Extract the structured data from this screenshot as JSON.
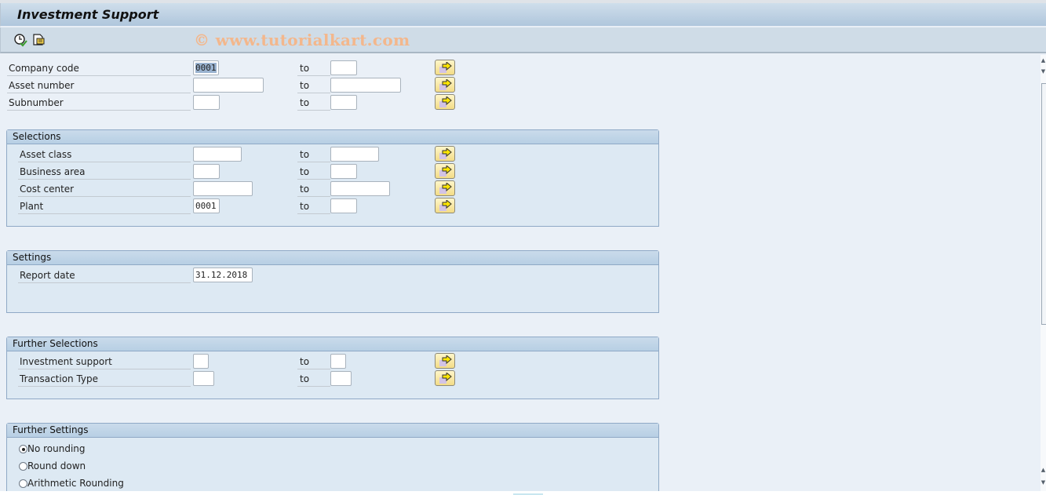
{
  "window": {
    "title": "Investment Support"
  },
  "toolbar": {
    "icons": [
      "execute-icon",
      "get-variant-icon"
    ],
    "watermark": "© www.tutorialkart.com"
  },
  "top_fields": [
    {
      "label": "Company code",
      "from": "0001",
      "to": "",
      "from_selected": true
    },
    {
      "label": "Asset number",
      "from": "",
      "to": ""
    },
    {
      "label": "Subnumber",
      "from": "",
      "to": ""
    }
  ],
  "to_label": "to",
  "selections": {
    "title": "Selections",
    "fields": [
      {
        "label": "Asset class",
        "from": "",
        "to": ""
      },
      {
        "label": "Business area",
        "from": "",
        "to": ""
      },
      {
        "label": "Cost center",
        "from": "",
        "to": ""
      },
      {
        "label": "Plant",
        "from": "0001",
        "to": ""
      }
    ]
  },
  "settings": {
    "title": "Settings",
    "report_date_label": "Report date",
    "report_date_value": "31.12.2018"
  },
  "further_selections": {
    "title": "Further Selections",
    "fields": [
      {
        "label": "Investment support",
        "from": "",
        "to": ""
      },
      {
        "label": "Transaction Type",
        "from": "",
        "to": ""
      }
    ]
  },
  "further_settings": {
    "title": "Further Settings",
    "options": [
      {
        "label": "No rounding",
        "selected": true
      },
      {
        "label": "Round down",
        "selected": false
      },
      {
        "label": "Arithmetic Rounding",
        "selected": false
      }
    ]
  },
  "colors": {
    "accent_watermark": "#f3b78c",
    "multiple_selection_button": "#f3dc86"
  }
}
